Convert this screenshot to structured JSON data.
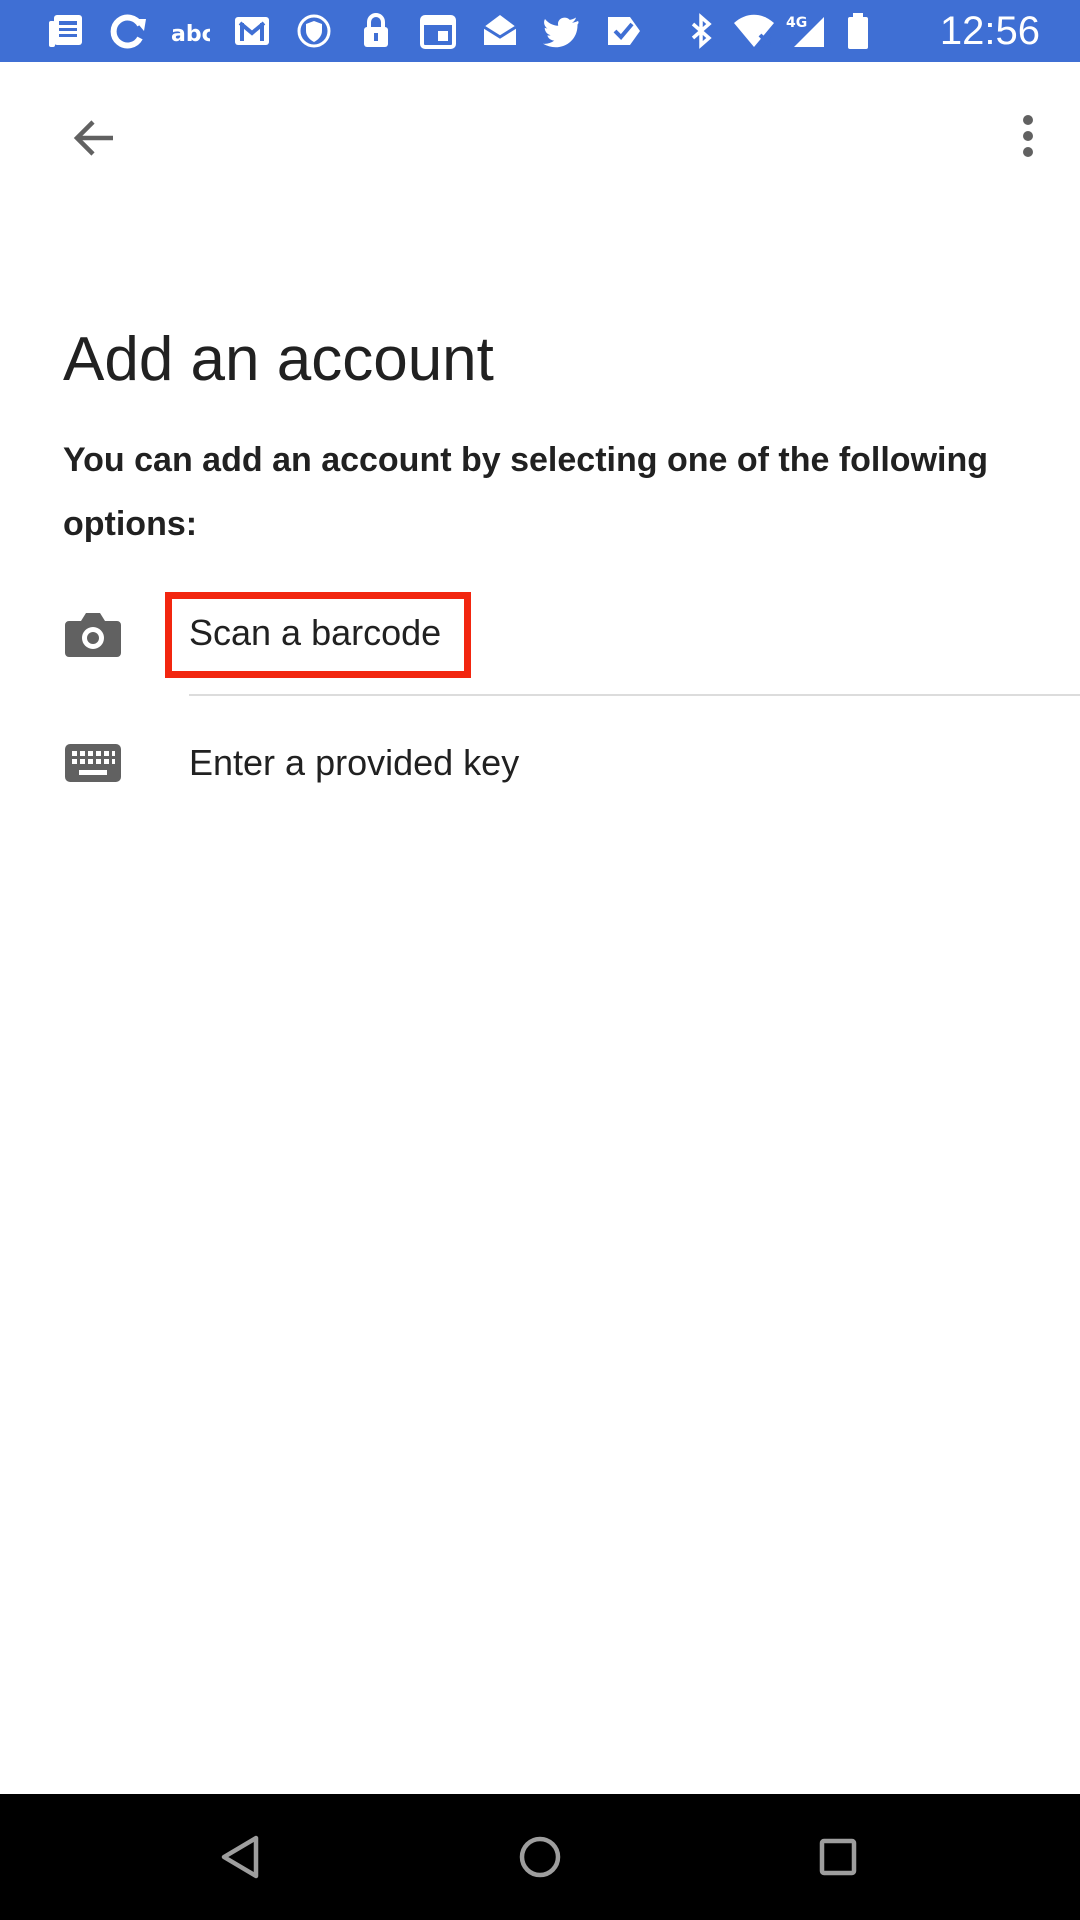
{
  "status_bar": {
    "time": "12:56",
    "network_label": "4G",
    "background_color": "#3f6fd4",
    "notification_icons": [
      "news-icon",
      "sync-icon",
      "abc-icon",
      "gmail-icon",
      "vpn-shield-icon",
      "lock-hand-icon",
      "calendar-icon",
      "email-icon",
      "twitter-icon",
      "tasks-icon"
    ],
    "system_icons": [
      "bluetooth-icon",
      "wifi-icon",
      "cellular-signal-icon",
      "battery-icon"
    ]
  },
  "app_bar": {
    "back_icon": "arrow-back-icon",
    "menu_icon": "more-vert-icon"
  },
  "content": {
    "title": "Add an account",
    "description": "You can add an account by selecting one of the following options:",
    "options": [
      {
        "label": "Scan a barcode",
        "icon": "camera-icon",
        "highlighted": true
      },
      {
        "label": "Enter a provided key",
        "icon": "keyboard-icon",
        "highlighted": false
      }
    ],
    "highlight_color": "#f2260f"
  },
  "nav_bar": {
    "buttons": [
      "nav-back-icon",
      "nav-home-icon",
      "nav-recents-icon"
    ]
  }
}
